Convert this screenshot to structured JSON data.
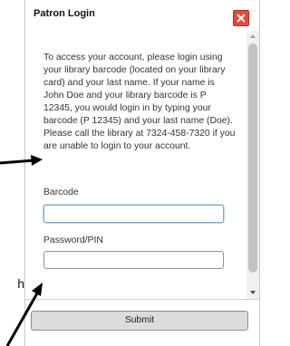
{
  "dialog": {
    "title": "Patron Login",
    "instructions": "To access your account, please login using your library barcode (located on your library card) and your last name. If your name is John Doe and your library barcode is P 12345, you would login in by typing your barcode (P 12345) and your last name (Doe). Please call the library at 7324-458-7320 if you are unable to login to your account.",
    "fields": {
      "barcode": {
        "label": "Barcode",
        "value": "",
        "placeholder": ""
      },
      "password": {
        "label": "Password/PIN",
        "value": "",
        "placeholder": ""
      }
    },
    "submit_label": "Submit"
  },
  "annotation": {
    "partial_text": "h"
  },
  "icons": {
    "close": "close-icon",
    "scroll_up": "chevron-up-icon",
    "scroll_down": "chevron-down-icon"
  },
  "colors": {
    "close_button": "#e8473f",
    "focus_border": "#7aa7d6",
    "submit_background": "#dcdcdc"
  }
}
